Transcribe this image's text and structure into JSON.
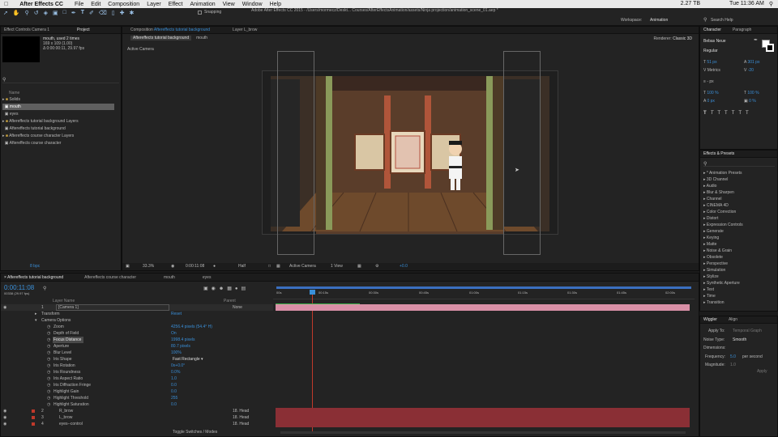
{
  "menubar": {
    "app_name": "After Effects CC",
    "items": [
      "File",
      "Edit",
      "Composition",
      "Layer",
      "Effect",
      "Animation",
      "View",
      "Window",
      "Help"
    ],
    "status": [
      "2.27 TB",
      "Tue 11:36 AM"
    ]
  },
  "toolbar": {
    "snapping_label": "Snapping",
    "path": "Adobe After Effects CC 2015 - /Users/mormecz/Deskt... Courses/AfterEffectsAnimation/assets/Ninja projection/animation_scene_01.aep *",
    "workspace_label": "Workspace:",
    "workspace_value": "Animation",
    "search_help": "Search Help"
  },
  "project_panel": {
    "tab_effect_controls": "Effect Controls Camera 1",
    "tab_project": "Project",
    "selected_name": "mouth",
    "used": ", used 2 times",
    "dims": "169 x 109 (1.00)",
    "duration": "Δ 0:00:00:11, 29.97 fps",
    "name_col": "Name",
    "items": [
      "Solids",
      "mouth",
      "eyes",
      "Aftereffects tutorial background Layers",
      "Aftereffects tutorial background",
      "Aftereffects course character Layers",
      "Aftereffects course character"
    ],
    "bpc": "8 bpc"
  },
  "comp_panel": {
    "comp_label": "Composition",
    "comp_name": "Aftereffects tutorial background",
    "layer_label": "Layer",
    "layer_name": "L_brow",
    "breadcrumb_1": "Aftereffects tutorial background",
    "breadcrumb_2": "mouth",
    "renderer_label": "Renderer:",
    "renderer_value": "Classic 3D",
    "active_camera": "Active Camera",
    "footer": {
      "zoom": "33.3%",
      "timecode": "0:00:11:08",
      "resolution": "Half",
      "view": "Active Camera",
      "views": "1 View",
      "exposure": "+0.0"
    }
  },
  "character_panel": {
    "tab_character": "Character",
    "tab_paragraph": "Paragraph",
    "font": "Bebas Neue",
    "style": "Regular",
    "size": "51 px",
    "leading": "301 px",
    "kerning": "Metrics",
    "tracking": "-20",
    "stroke": "- px",
    "vscale": "100 %",
    "hscale": "100 %",
    "baseline": "0 px",
    "tsume": "0 %"
  },
  "effects_panel": {
    "title": "Effects & Presets",
    "items": [
      "* Animation Presets",
      "3D Channel",
      "Audio",
      "Blur & Sharpen",
      "Channel",
      "CINEMA 4D",
      "Color Correction",
      "Distort",
      "Expression Controls",
      "Generate",
      "Keying",
      "Matte",
      "Noise & Grain",
      "Obsolete",
      "Perspective",
      "Simulation",
      "Stylize",
      "Synthetic Aperture",
      "Text",
      "Time",
      "Transition"
    ]
  },
  "wiggler_panel": {
    "tab_wiggler": "Wiggler",
    "tab_align": "Align",
    "apply_to_label": "Apply To:",
    "apply_to_value": "Temporal Graph",
    "noise_label": "Noise Type:",
    "noise_value": "Smooth",
    "dimensions_label": "Dimensions:",
    "frequency_label": "Frequency:",
    "frequency_value": "5.0",
    "frequency_unit": "per second",
    "magnitude_label": "Magnitude:",
    "magnitude_value": "1.0",
    "apply_button": "Apply"
  },
  "timeline": {
    "tabs": [
      "Aftereffects tutorial background",
      "Aftereffects course character",
      "mouth",
      "eyes"
    ],
    "timecode": "0:00:11:08",
    "frames": "00338 (29.97 fps)",
    "col_layer_name": "Layer Name",
    "col_parent": "Parent",
    "ruler": [
      "00s",
      "00:15s",
      "00:30s",
      "00:45s",
      "01:00s",
      "01:15s",
      "01:30s",
      "01:45s",
      "02:00s"
    ],
    "camera_layer": {
      "num": "1",
      "name": "[Camera 1]",
      "parent": "None"
    },
    "props": [
      {
        "name": "Transform",
        "value": "Reset"
      },
      {
        "name": "Camera Options",
        "value": ""
      },
      {
        "name": "Zoom",
        "value": "4256.4 pixels (54.4° H)"
      },
      {
        "name": "Depth of Field",
        "value": "On"
      },
      {
        "name": "Focus Distance",
        "value": "1998.4 pixels"
      },
      {
        "name": "Aperture",
        "value": "80.7 pixels"
      },
      {
        "name": "Blur Level",
        "value": "100%"
      },
      {
        "name": "Iris Shape",
        "value": "Fast Rectangle"
      },
      {
        "name": "Iris Rotation",
        "value": "0x+0.0°"
      },
      {
        "name": "Iris Roundness",
        "value": "0.0%"
      },
      {
        "name": "Iris Aspect Ratio",
        "value": "1.0"
      },
      {
        "name": "Iris Diffraction Fringe",
        "value": "0.0"
      },
      {
        "name": "Highlight Gain",
        "value": "0.0"
      },
      {
        "name": "Highlight Threshold",
        "value": "255"
      },
      {
        "name": "Highlight Saturation",
        "value": "0.0"
      }
    ],
    "layers": [
      {
        "num": "2",
        "name": "R_brow",
        "parent": "18. Head"
      },
      {
        "num": "3",
        "name": "L_brow",
        "parent": "18. Head"
      },
      {
        "num": "4",
        "name": "eyes--control",
        "parent": "18. Head"
      }
    ],
    "toggle_label": "Toggle Switches / Modes"
  }
}
